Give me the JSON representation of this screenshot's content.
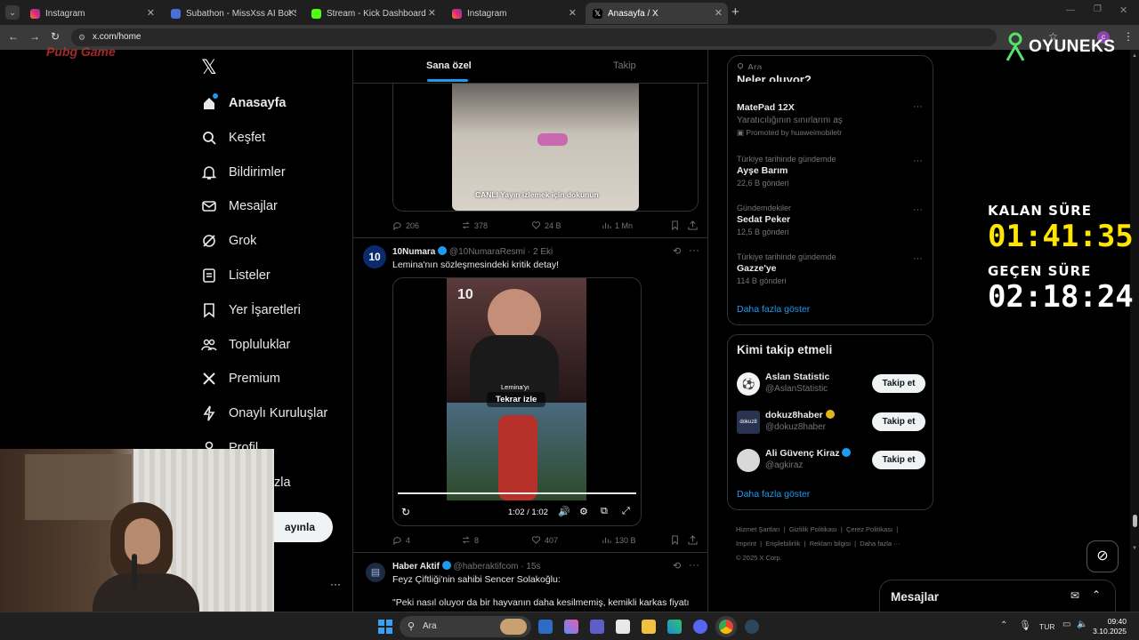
{
  "browser": {
    "tabs": [
      {
        "title": "Instagram"
      },
      {
        "title": "Subathon - MissXss AI Bot Syst"
      },
      {
        "title": "Stream - Kick Dashboard"
      },
      {
        "title": "Instagram"
      },
      {
        "title": "Anasayfa / X"
      }
    ],
    "url": "x.com/home",
    "watermark_text": "Pubg Game"
  },
  "sidebar": {
    "items": [
      {
        "label": "Anasayfa",
        "icon": "home-icon"
      },
      {
        "label": "Keşfet",
        "icon": "search-icon"
      },
      {
        "label": "Bildirimler",
        "icon": "bell-icon"
      },
      {
        "label": "Mesajlar",
        "icon": "mail-icon"
      },
      {
        "label": "Grok",
        "icon": "grok-icon"
      },
      {
        "label": "Listeler",
        "icon": "list-icon"
      },
      {
        "label": "Yer İşaretleri",
        "icon": "bookmark-icon"
      },
      {
        "label": "Topluluklar",
        "icon": "people-icon"
      },
      {
        "label": "Premium",
        "icon": "x-icon"
      },
      {
        "label": "Onaylı Kuruluşlar",
        "icon": "lightning-icon"
      },
      {
        "label": "Profil",
        "icon": "person-icon"
      }
    ],
    "partial_more_label": "zla",
    "post_button_label": "ayınla",
    "more_dots": "···"
  },
  "feed": {
    "tabs": [
      {
        "label": "Sana özel"
      },
      {
        "label": "Takip"
      }
    ],
    "post1": {
      "overlay_text": "CANLI Yayın izlemek için dokunun",
      "replies": "206",
      "reposts": "378",
      "likes": "24 B",
      "views": "1 Mn"
    },
    "post2": {
      "author": "10Numara",
      "handle": "@10NumaraResmi",
      "date": "· 2 Eki",
      "text": "Lemina'nın sözleşmesindeki kritik detay!",
      "avatar_text": "10",
      "video_caption_small": "Lemina'yı",
      "video_caption": "Tekrar izle",
      "video_time": "1:02 / 1:02",
      "logo_text": "10",
      "replies": "4",
      "reposts": "8",
      "likes": "407",
      "views": "130 B"
    },
    "post3": {
      "author": "Haber Aktif",
      "handle": "@haberaktifcom",
      "date": "· 15s",
      "text": "Feyz Çiftliği'nin sahibi Sencer Solakoğlu:",
      "quote": "\"Peki nasıl oluyor da bir hayvanın daha kesilmemiş, kemikli karkas fiyatı"
    }
  },
  "right": {
    "search_placeholder": "Ara",
    "trends_header": "Neler oluyor?",
    "trends": [
      {
        "name": "MatePad 12X",
        "meta": "Yaratıcılığının sınırlarını aş",
        "promo": "Promoted by huaweimobiletr"
      },
      {
        "meta": "Türkiye tarihinde gündemde",
        "name": "Ayşe Barım",
        "count": "22,6 B gönderi"
      },
      {
        "meta": "Gündemdekiler",
        "name": "Sedat Peker",
        "count": "12,5 B gönderi"
      },
      {
        "meta": "Türkiye tarihinde gündemde",
        "name": "Gazze'ye",
        "count": "114 B gönderi"
      }
    ],
    "show_more": "Daha fazla göster",
    "who_to_follow": {
      "title": "Kimi takip etmeli",
      "users": [
        {
          "name": "Aslan Statistic",
          "handle": "@AslanStatistic",
          "button": "Takip et"
        },
        {
          "name": "dokuz8haber",
          "handle": "@dokuz8haber",
          "button": "Takip et"
        },
        {
          "name": "Ali Güvenç Kiraz",
          "handle": "@agkiraz",
          "button": "Takip et"
        }
      ],
      "show_more": "Daha fazla göster"
    },
    "footer": {
      "links": [
        "Hizmet Şartları",
        "Gizlilik Politikası",
        "Çerez Politikası",
        "Imprint",
        "Erişilebilirlik",
        "Reklam bilgisi",
        "Daha fazla ···"
      ],
      "copyright": "© 2025 X Corp."
    },
    "messages_label": "Mesajlar"
  },
  "overlay": {
    "brand": "OYUNEKS",
    "timer1_label": "KALAN SÜRE",
    "timer1_value": "01:41:35",
    "timer2_label": "GEÇEN SÜRE",
    "timer2_value": "02:18:24",
    "timer1_color": "#ffe600",
    "timer2_color": "#ffffff"
  },
  "taskbar": {
    "search_placeholder": "Ara",
    "language": "TUR",
    "time": "09:40",
    "date": "3.10.2025"
  }
}
